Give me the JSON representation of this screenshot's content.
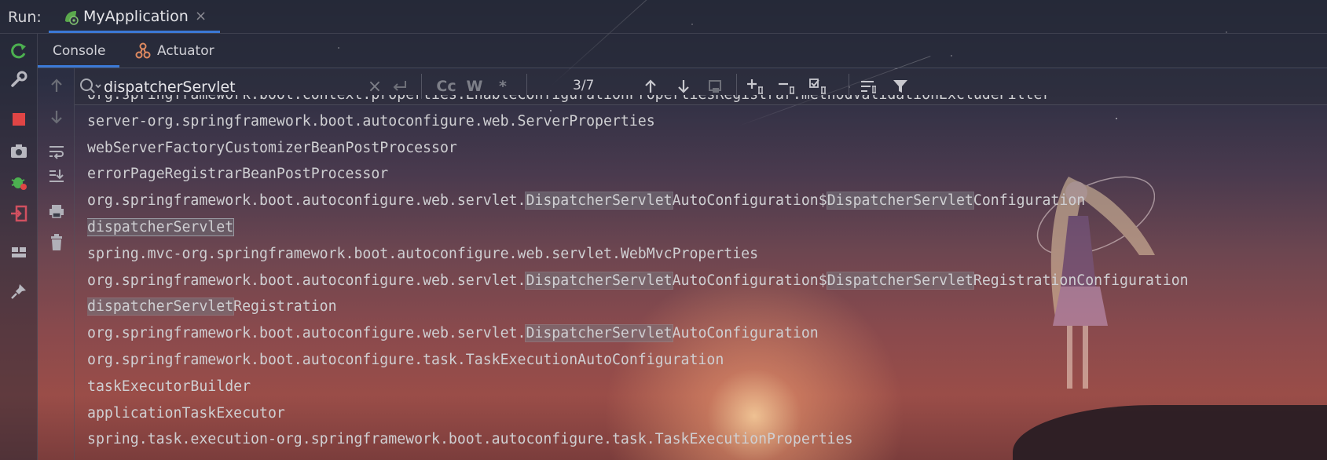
{
  "run_bar": {
    "label": "Run:",
    "tab_title": "MyApplication",
    "close_glyph": "×"
  },
  "sub_tabs": [
    {
      "label": "Console",
      "active": true
    },
    {
      "label": "Actuator",
      "active": false
    }
  ],
  "find": {
    "query": "dispatcherServlet",
    "match_count": "3/7",
    "case_label": "Cc",
    "word_label": "W",
    "regex_label": "*"
  },
  "log_lines": [
    "org.springframework.boot.context.properties.EnableConfigurationPropertiesRegistrar.methodValidationExcludeFilter",
    "server-org.springframework.boot.autoconfigure.web.ServerProperties",
    "webServerFactoryCustomizerBeanPostProcessor",
    "errorPageRegistrarBeanPostProcessor",
    [
      {
        "t": "org.springframework.boot.autoconfigure.web.servlet."
      },
      {
        "t": "DispatcherServlet",
        "hl": 1
      },
      {
        "t": "AutoConfiguration$"
      },
      {
        "t": "DispatcherServlet",
        "hl": 1
      },
      {
        "t": "Configuration"
      }
    ],
    [
      {
        "t": "dispatcherServlet",
        "hl": 2
      }
    ],
    "spring.mvc-org.springframework.boot.autoconfigure.web.servlet.WebMvcProperties",
    [
      {
        "t": "org.springframework.boot.autoconfigure.web.servlet."
      },
      {
        "t": "DispatcherServlet",
        "hl": 1
      },
      {
        "t": "AutoConfiguration$"
      },
      {
        "t": "DispatcherServlet",
        "hl": 1
      },
      {
        "t": "RegistrationConfiguration"
      }
    ],
    [
      {
        "t": "dispatcherServlet",
        "hl": 1
      },
      {
        "t": "Registration"
      }
    ],
    [
      {
        "t": "org.springframework.boot.autoconfigure.web.servlet."
      },
      {
        "t": "DispatcherServlet",
        "hl": 1
      },
      {
        "t": "AutoConfiguration"
      }
    ],
    "org.springframework.boot.autoconfigure.task.TaskExecutionAutoConfiguration",
    "taskExecutorBuilder",
    "applicationTaskExecutor",
    "spring.task.execution-org.springframework.boot.autoconfigure.task.TaskExecutionProperties"
  ],
  "colors": {
    "accent": "#3b79d6",
    "rerun": "#4cb050",
    "stop": "#e04545",
    "exit": "#d05060"
  }
}
